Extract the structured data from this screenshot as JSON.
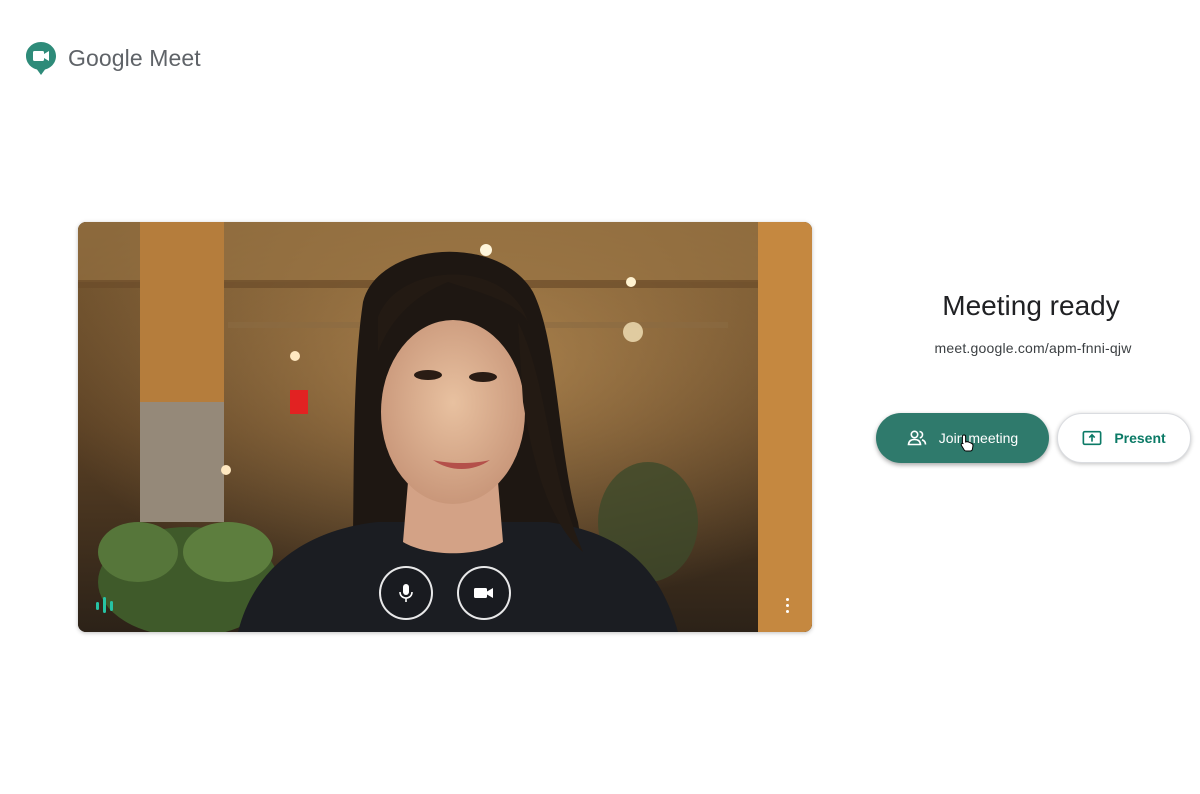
{
  "app": {
    "brand_name": "Google Meet",
    "brand_color": "#00897b"
  },
  "preview": {
    "mic_icon": "microphone-icon",
    "camera_icon": "camera-icon",
    "audio_indicator_icon": "audio-level-icon",
    "more_icon": "more-vert-icon"
  },
  "panel": {
    "title": "Meeting ready",
    "meeting_link": "meet.google.com/apm-fnni-qjw",
    "join_label": "Join meeting",
    "join_icon": "people-icon",
    "present_label": "Present",
    "present_icon": "present-screen-icon",
    "accent_color": "#2f7a6c"
  }
}
